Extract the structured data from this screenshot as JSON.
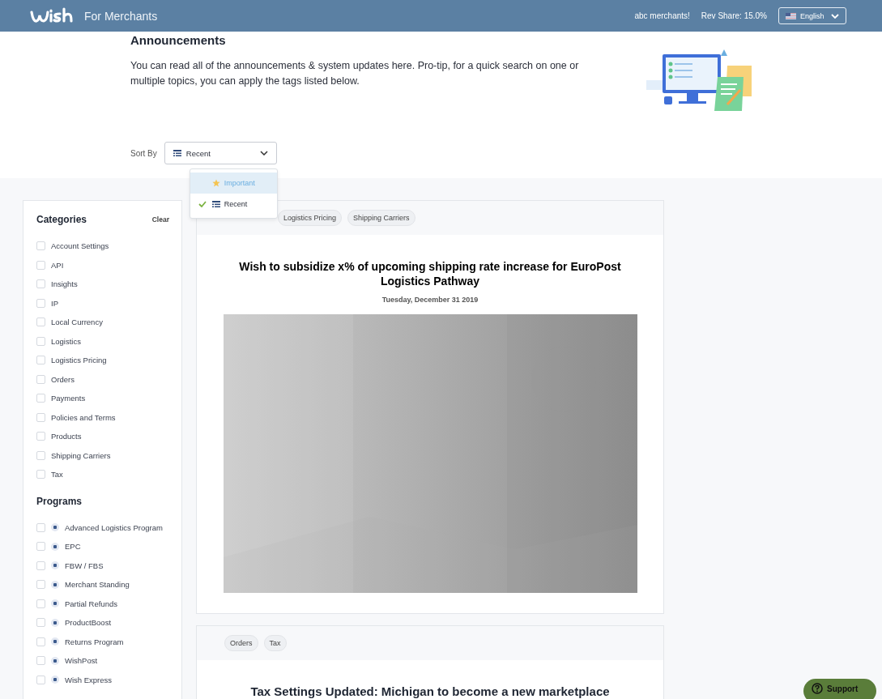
{
  "header": {
    "brand": "For Merchants",
    "user": "abc merchants!",
    "rev_share": "Rev Share: 15.0%",
    "language": "English"
  },
  "intro": {
    "title": "Announcements",
    "text": "You can read all of the announcements & system updates here. Pro-tip, for a quick search on one or multiple topics, you can apply the tags listed below."
  },
  "sort": {
    "label": "Sort By",
    "value": "Recent",
    "expanded": true,
    "options": [
      {
        "label": "Important",
        "kind": "star",
        "selected": false,
        "highlighted": true
      },
      {
        "label": "Recent",
        "kind": "list",
        "selected": true,
        "highlighted": false
      }
    ]
  },
  "categories": {
    "title": "Categories",
    "clear": "Clear",
    "items": [
      {
        "label": "Account Settings",
        "checked": false
      },
      {
        "label": "API",
        "checked": false
      },
      {
        "label": "Insights",
        "checked": false
      },
      {
        "label": "IP",
        "checked": false
      },
      {
        "label": "Local Currency",
        "checked": false
      },
      {
        "label": "Logistics",
        "checked": false
      },
      {
        "label": "Logistics Pricing",
        "checked": false
      },
      {
        "label": "Orders",
        "checked": false
      },
      {
        "label": "Payments",
        "checked": false
      },
      {
        "label": "Policies and Terms",
        "checked": false
      },
      {
        "label": "Products",
        "checked": false
      },
      {
        "label": "Shipping Carriers",
        "checked": false
      },
      {
        "label": "Tax",
        "checked": false
      }
    ]
  },
  "programs": {
    "title": "Programs",
    "items": [
      {
        "label": "Advanced Logistics Program",
        "checked": false
      },
      {
        "label": "EPC",
        "checked": false
      },
      {
        "label": "FBW / FBS",
        "checked": false
      },
      {
        "label": "Merchant Standing",
        "checked": false
      },
      {
        "label": "Partial Refunds",
        "checked": false
      },
      {
        "label": "ProductBoost",
        "checked": false
      },
      {
        "label": "Returns Program",
        "checked": false
      },
      {
        "label": "WishPost",
        "checked": false
      },
      {
        "label": "Wish Express",
        "checked": false
      }
    ]
  },
  "posts": [
    {
      "tags": [
        "Logistics Pricing",
        "Shipping Carriers"
      ],
      "title": "Wish to subsidize x% of upcoming shipping rate increase for EuroPost Logistics Pathway",
      "date": "Tuesday, December 31 2019"
    },
    {
      "tags": [
        "Orders",
        "Tax"
      ],
      "title": "Tax Settings Updated: Michigan to become a new marketplace"
    }
  ],
  "support": "Support"
}
